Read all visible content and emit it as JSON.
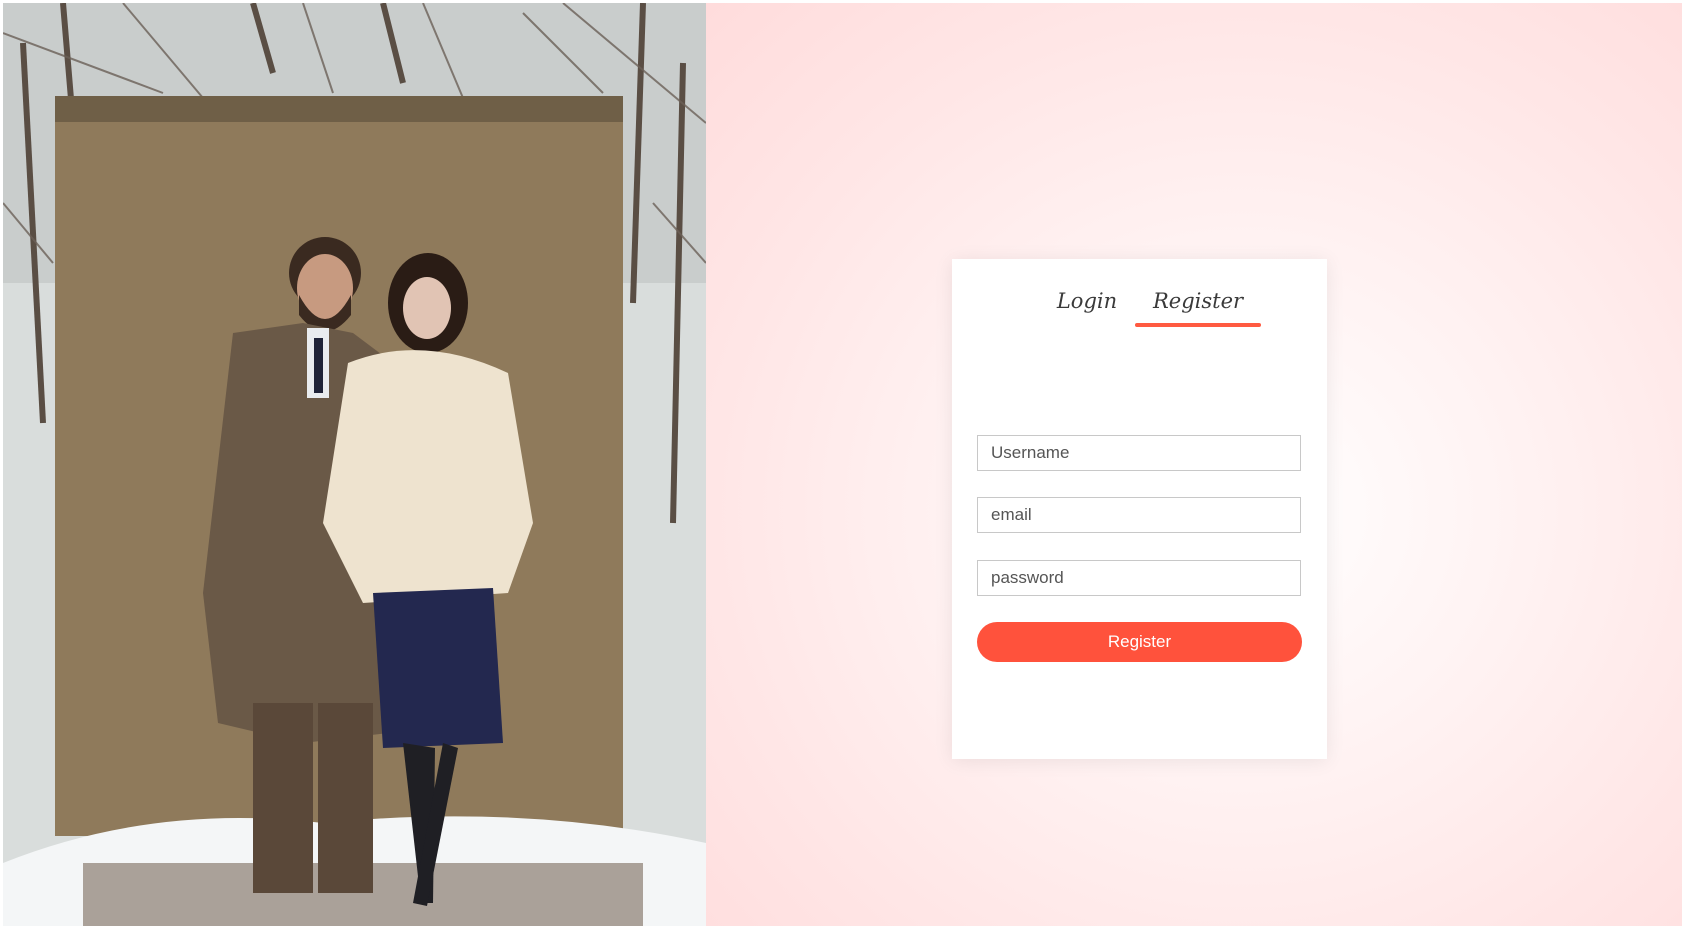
{
  "tabs": [
    {
      "label": "Login",
      "active": false
    },
    {
      "label": "Register",
      "active": true
    }
  ],
  "form": {
    "username_placeholder": "Username",
    "email_placeholder": "email",
    "password_placeholder": "password",
    "submit_label": "Register"
  },
  "colors": {
    "accent": "#ff523c",
    "background_tint": "#ffe6e6"
  },
  "image": {
    "subject": "fashion photo of a couple in winter coats standing in snow in front of a burlap backdrop"
  }
}
